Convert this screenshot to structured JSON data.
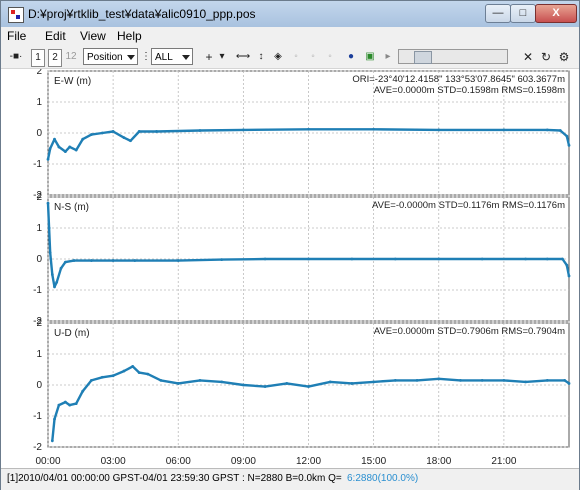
{
  "window": {
    "title": "D:¥proj¥rtklib_test¥data¥alic0910_ppp.pos",
    "min_label": "—",
    "max_label": "□",
    "close_label": "X"
  },
  "menu": [
    "File",
    "Edit",
    "View",
    "Help"
  ],
  "toolbar": {
    "button_1": "1",
    "button_2": "2",
    "button_12": "12",
    "plot_type": "Position",
    "sat_filter": "ALL"
  },
  "status": {
    "left": "[1]2010/04/01 00:00:00 GPST-04/01 23:59:30 GPST : N=2880 B=0.0km Q=",
    "quality": "6:2880(100.0%)",
    "quality_color": "#2a8fd0"
  },
  "chart_data": [
    {
      "type": "scatter",
      "title": "E-W (m)",
      "series_color": "#1f7fb5",
      "ylim": [
        -2,
        2
      ],
      "yticks": [
        "2",
        "1",
        "0",
        "-1",
        "-2"
      ],
      "annotations": [
        "ORI=-23°40'12.4158\"  133°53'07.8645\"  603.3677m",
        "AVE=0.0000m STD=0.1598m RMS=0.1598m"
      ],
      "x": [
        0,
        0.1,
        0.3,
        0.5,
        0.8,
        1.0,
        1.3,
        1.6,
        2.0,
        2.5,
        3.0,
        3.5,
        3.8,
        4.2,
        5,
        7,
        9,
        12,
        15,
        18,
        21,
        23,
        23.6,
        23.9,
        24
      ],
      "y": [
        -0.85,
        -0.5,
        -0.2,
        -0.45,
        -0.6,
        -0.45,
        -0.55,
        -0.2,
        -0.05,
        0,
        0.05,
        -0.15,
        -0.25,
        0.05,
        0.05,
        0.08,
        0.1,
        0.12,
        0.12,
        0.1,
        0.1,
        0.1,
        0.08,
        -0.1,
        -0.4
      ]
    },
    {
      "type": "scatter",
      "title": "N-S (m)",
      "series_color": "#1f7fb5",
      "ylim": [
        -2,
        2
      ],
      "yticks": [
        "2",
        "1",
        "0",
        "-1",
        "-2"
      ],
      "annotations": [
        "AVE=-0.0000m STD=0.1176m RMS=0.1176m"
      ],
      "x": [
        0,
        0.05,
        0.1,
        0.2,
        0.3,
        0.4,
        0.6,
        0.8,
        1.2,
        2,
        3,
        4,
        6,
        8,
        10,
        12,
        14,
        16,
        18,
        20,
        22,
        23,
        23.7,
        23.9,
        24
      ],
      "y": [
        1.8,
        1.0,
        0.2,
        -0.5,
        -0.9,
        -0.75,
        -0.3,
        -0.1,
        -0.05,
        -0.05,
        -0.05,
        -0.05,
        -0.05,
        -0.02,
        0,
        0,
        0,
        0,
        0,
        0,
        0,
        0,
        0,
        -0.2,
        -0.55
      ]
    },
    {
      "type": "scatter",
      "title": "U-D (m)",
      "series_color": "#1f7fb5",
      "ylim": [
        -2,
        2
      ],
      "yticks": [
        "2",
        "1",
        "0",
        "-1",
        "-2"
      ],
      "annotations": [
        "AVE=0.0000m STD=0.7906m RMS=0.7904m"
      ],
      "x": [
        0.2,
        0.3,
        0.5,
        0.8,
        1.0,
        1.3,
        1.6,
        2.0,
        2.5,
        3.0,
        3.5,
        3.9,
        4.2,
        4.6,
        5.2,
        6,
        7,
        8,
        9,
        10,
        11,
        12,
        13,
        14,
        15,
        16,
        17,
        18,
        19,
        20,
        21,
        22,
        23,
        23.8,
        24
      ],
      "y": [
        -1.8,
        -1.1,
        -0.65,
        -0.55,
        -0.65,
        -0.6,
        -0.2,
        0.15,
        0.25,
        0.3,
        0.45,
        0.6,
        0.4,
        0.35,
        0.15,
        0.05,
        0.15,
        0.1,
        0.0,
        -0.05,
        0.05,
        -0.05,
        0.1,
        0.05,
        0.1,
        0.15,
        0.15,
        0.2,
        0.15,
        0.15,
        0.15,
        0.1,
        0.15,
        0.15,
        0.05
      ]
    }
  ],
  "x_axis": {
    "ticks": [
      "00:00",
      "03:00",
      "06:00",
      "09:00",
      "12:00",
      "15:00",
      "18:00",
      "21:00"
    ],
    "range_hours": [
      0,
      24
    ]
  }
}
